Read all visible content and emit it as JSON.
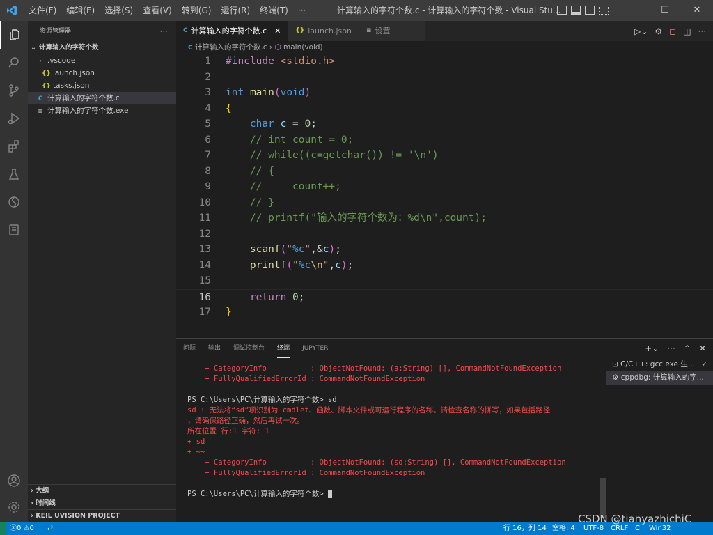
{
  "titlebar": {
    "menus": [
      "文件(F)",
      "编辑(E)",
      "选择(S)",
      "查看(V)",
      "转到(G)",
      "运行(R)",
      "终端(T)",
      "···"
    ],
    "title": "计算输入的字符个数.c - 计算输入的字符个数 - Visual Stu...",
    "min": "—",
    "max": "☐",
    "close": "✕"
  },
  "sidebar": {
    "header": "资源管理器",
    "more": "···",
    "folder": "计算输入的字符个数",
    "items": [
      {
        "label": ".vscode",
        "icon": "›",
        "indent": 1
      },
      {
        "label": "launch.json",
        "icon": "{}",
        "indent": 2
      },
      {
        "label": "tasks.json",
        "icon": "{}",
        "indent": 2
      },
      {
        "label": "计算输入的字符个数.c",
        "icon": "C",
        "indent": 1
      },
      {
        "label": "计算输入的字符个数.exe",
        "icon": "≡",
        "indent": 1
      }
    ],
    "sections": [
      "大纲",
      "时间线",
      "KEIL UVISION PROJECT"
    ]
  },
  "tabs": [
    {
      "label": "计算输入的字符个数.c",
      "icon": "C",
      "active": true
    },
    {
      "label": "launch.json",
      "icon": "{}",
      "active": false
    },
    {
      "label": "设置",
      "icon": "≡",
      "active": false
    }
  ],
  "breadcrumb": {
    "file": "计算输入的字符个数.c",
    "sep": "›",
    "symbol": "main(void)"
  },
  "editor": {
    "line_numbers": [
      "1",
      "2",
      "3",
      "4",
      "5",
      "6",
      "7",
      "8",
      "9",
      "10",
      "11",
      "12",
      "13",
      "14",
      "15",
      "16",
      "17"
    ],
    "current_line": 16
  },
  "panel": {
    "tabs": [
      "问题",
      "输出",
      "调试控制台",
      "终端",
      "JUPYTER"
    ],
    "active_tab": "终端",
    "terminal_lines": [
      {
        "text": "    + CategoryInfo          : ObjectNotFound: (a:String) [], CommandNotFoundException",
        "type": "err"
      },
      {
        "text": "    + FullyQualifiedErrorId : CommandNotFoundException",
        "type": "err"
      },
      {
        "text": "",
        "type": "norm"
      },
      {
        "text": "PS C:\\Users\\PC\\计算输入的字符个数> sd",
        "type": "norm"
      },
      {
        "text": "sd : 无法将“sd”项识别为 cmdlet、函数、脚本文件或可运行程序的名称。请检查名称的拼写，如果包括路径",
        "type": "err"
      },
      {
        "text": "，请确保路径正确，然后再试一次。",
        "type": "err"
      },
      {
        "text": "所在位置 行:1 字符: 1",
        "type": "err"
      },
      {
        "text": "+ sd",
        "type": "err"
      },
      {
        "text": "+ ~~",
        "type": "err"
      },
      {
        "text": "    + CategoryInfo          : ObjectNotFound: (sd:String) [], CommandNotFoundException",
        "type": "err"
      },
      {
        "text": "    + FullyQualifiedErrorId : CommandNotFoundException",
        "type": "err"
      },
      {
        "text": "",
        "type": "norm"
      },
      {
        "text": "PS C:\\Users\\PC\\计算输入的字符个数> ",
        "type": "prompt"
      }
    ],
    "terminals": [
      {
        "label": "C/C++: gcc.exe 生...",
        "icon": "terminal-icon",
        "check": "✓"
      },
      {
        "label": "cppdbg: 计算输入的字...",
        "icon": "debug-gear-icon"
      }
    ]
  },
  "statusbar": {
    "errors": "0",
    "warnings": "0",
    "position": "行 16，列 14",
    "spaces": "空格: 4",
    "encoding": "UTF-8",
    "eol": "CRLF",
    "language": "C",
    "platform": "Win32"
  },
  "watermark": "CSDN @tianyazhichiC",
  "colors": {
    "accent": "#007acc",
    "error": "#f14c4c",
    "titlebar": "#3c3c3c"
  }
}
